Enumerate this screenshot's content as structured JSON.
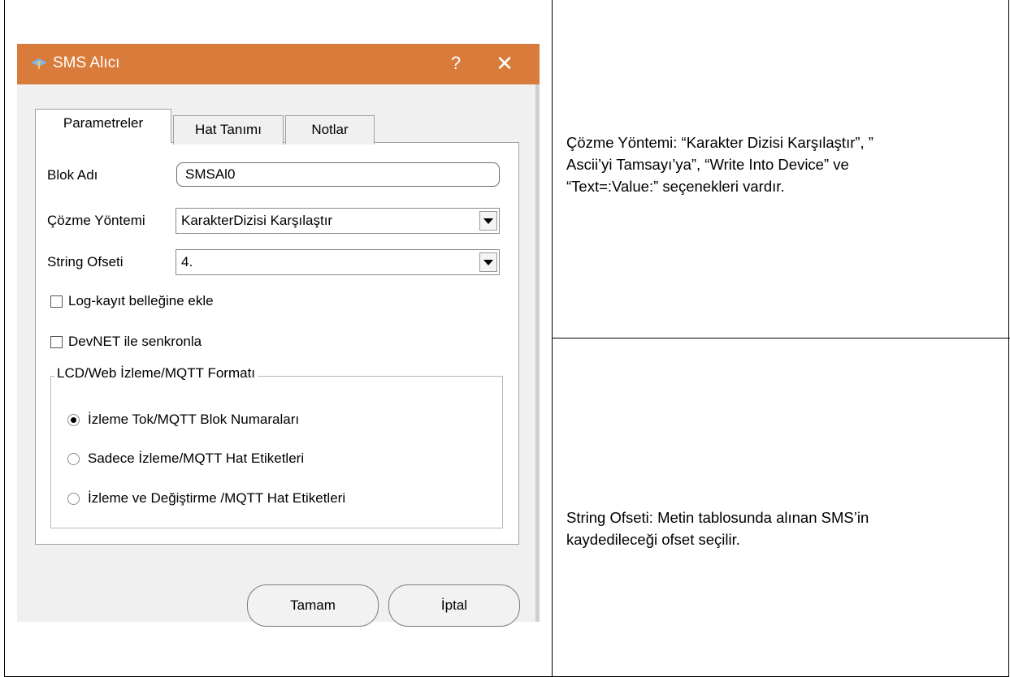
{
  "dialog": {
    "title": "SMS Alıcı",
    "help_label": "?",
    "close_label": "✕",
    "tabs": [
      {
        "label": "Parametreler"
      },
      {
        "label": "Hat Tanımı"
      },
      {
        "label": "Notlar"
      }
    ],
    "fields": {
      "block_name_label": "Blok Adı",
      "block_name_value": "SMSAl0",
      "decode_method_label": "Çözme Yöntemi",
      "decode_method_value": "KarakterDizisi Karşılaştır",
      "string_offset_label": "String Ofseti",
      "string_offset_value": "4."
    },
    "checkboxes": [
      {
        "label": "Log-kayıt belleğine ekle",
        "checked": false
      },
      {
        "label": "DevNET ile senkronla",
        "checked": false
      }
    ],
    "group": {
      "title": "LCD/Web İzleme/MQTT Formatı",
      "options": [
        {
          "label": "İzleme Tok/MQTT Blok Numaraları",
          "selected": true
        },
        {
          "label": "Sadece İzleme/MQTT Hat Etiketleri",
          "selected": false
        },
        {
          "label": "İzleme ve Değiştirme /MQTT Hat Etiketleri",
          "selected": false
        }
      ]
    },
    "buttons": {
      "ok": "Tamam",
      "cancel": "İptal"
    },
    "colors": {
      "titlebar": "#d97b3a"
    }
  },
  "notes": {
    "decode_method_line1": "Çözme Yöntemi:  “Karakter Dizisi Karşılaştır”, ”",
    "decode_method_line2": "Ascii’yi Tamsayı’ya”, “Write Into  Device” ve",
    "decode_method_line3": "“Text=:Value:” seçenekleri vardır.",
    "string_offset_line1": "String Ofseti:  Metin tablosunda alınan SMS’in",
    "string_offset_line2": "kaydedileceği ofset seçilir."
  }
}
